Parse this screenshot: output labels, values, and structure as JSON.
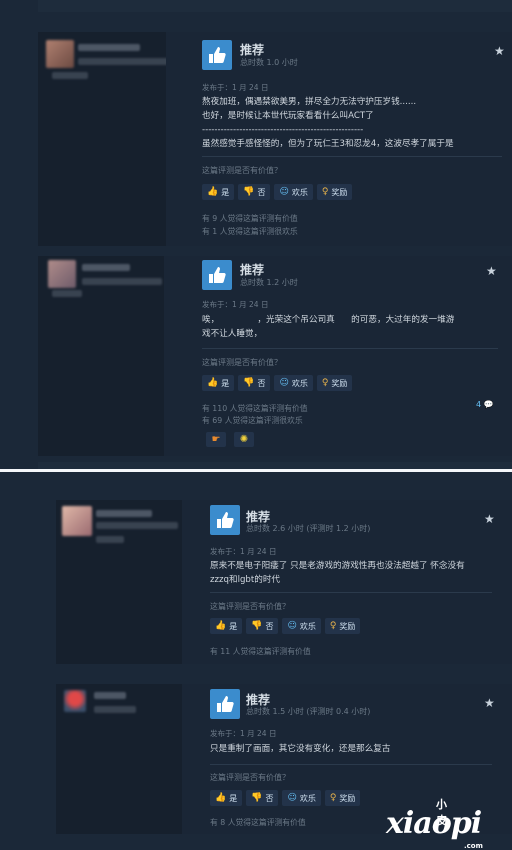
{
  "recommend_label": "推荐",
  "helpful_question": "这篇评测是否有价值？",
  "buttons": {
    "yes": "是",
    "no": "否",
    "funny": "欢乐",
    "award": "奖励"
  },
  "reviews": [
    {
      "hours": "总时数 1.0 小时",
      "posted": "发布于：1 月 24 日",
      "content": "熬夜加班，偶遇禁欲美男，拼尽全力无法守护压岁钱......\n也好，是时候让本世代玩家看看什么叫ACT了\n----------------------------------------------------\n虽然感觉手感怪怪的，但为了玩仁王3和忍龙4，这波尽孝了属于是",
      "helpful": "有 9 人觉得这篇评测有价值",
      "funny": "有 1 人觉得这篇评测很欢乐"
    },
    {
      "hours": "总时数 1.2 小时",
      "posted": "发布于：1 月 24 日",
      "content": "唉，              ，光荣这个吊公司真      的可恶，大过年的发一堆游\n戏不让人睡觉，",
      "helpful": "有 110 人觉得这篇评测有价值",
      "funny": "有 69 人觉得这篇评测很欢乐",
      "comments": "4"
    },
    {
      "hours": "总时数 2.6 小时  (评测时 1.2 小时)",
      "posted": "发布于：1 月 24 日",
      "content": "原来不是电子阳痿了 只是老游戏的游戏性再也没法超越了 怀念没有\nzzzq和lgbt的时代",
      "helpful": "有 11 人觉得这篇评测有价值"
    },
    {
      "hours": "总时数 1.5 小时  (评测时 0.4 小时)",
      "posted": "发布于：1 月 24 日",
      "content": "只是重制了画面，其它没有变化，还是那么复古",
      "helpful": "有 8 人觉得这篇评测有价值"
    }
  ],
  "watermark": {
    "small": "小皮",
    "large": "xiaopi",
    "tld": ".com"
  },
  "colors": {
    "background": "#1b2838",
    "thumb": "#3b8ccd",
    "link": "#66c0f4"
  }
}
